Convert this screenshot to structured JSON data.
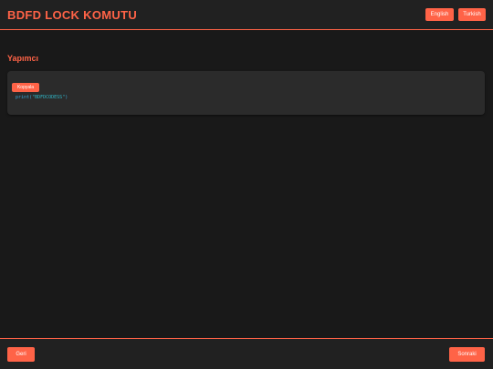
{
  "header": {
    "title": "BDFD LOCK KOMUTU",
    "lang_english": "English",
    "lang_turkish": "Turkish"
  },
  "main": {
    "section_title": "Yapımcı",
    "code_block": {
      "copy_label": "Kopyala",
      "fn": "print",
      "open": "(",
      "str": "\"BDFDCODESS\"",
      "close": ")"
    }
  },
  "footer": {
    "back_label": "Geri",
    "next_label": "Sonraki"
  },
  "colors": {
    "accent": "#ff6347",
    "background": "#191919",
    "bar": "#212121",
    "card": "#2b2b2b",
    "code": "#3aa7d8"
  }
}
